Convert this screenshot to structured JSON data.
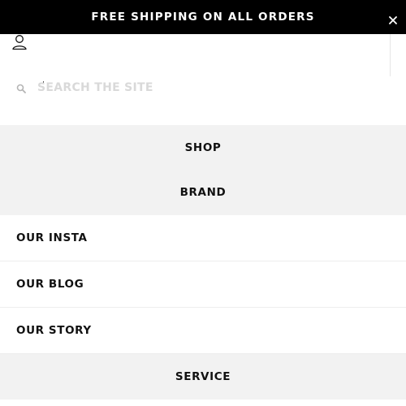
{
  "announcement": {
    "text": "FREE SHIPPING ON ALL ORDERS"
  },
  "icons": {
    "close": "close-icon",
    "user": "user-icon",
    "search": "search-icon"
  },
  "search": {
    "placeholder": "SEARCH THE SITE",
    "value": ""
  },
  "menu": {
    "primary": [
      {
        "label": "SHOP"
      },
      {
        "label": "BRAND"
      }
    ],
    "secondary": [
      {
        "label": "OUR INSTA"
      },
      {
        "label": "OUR BLOG"
      },
      {
        "label": "OUR STORY"
      }
    ],
    "footer": [
      {
        "label": "SERVICE"
      }
    ]
  },
  "colors": {
    "announcement_bg": "#000000",
    "announcement_text": "#ffffff",
    "menu_grey": "#f2f2f2",
    "placeholder": "#d9d9d9"
  }
}
